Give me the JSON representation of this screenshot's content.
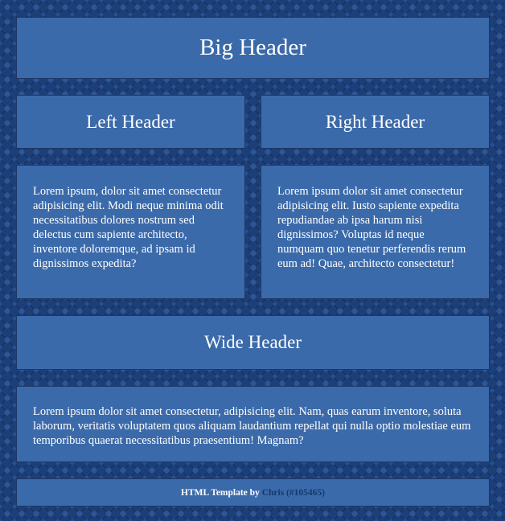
{
  "big_header": {
    "title": "Big Header"
  },
  "left_column": {
    "header": "Left Header",
    "text": "Lorem ipsum, dolor sit amet consectetur adipisicing elit. Modi neque minima odit necessitatibus dolores nostrum sed delectus cum sapiente architecto, inventore doloremque, ad ipsam id dignissimos expedita?"
  },
  "right_column": {
    "header": "Right Header",
    "text": "Lorem ipsum dolor sit amet consectetur adipisicing elit. Iusto sapiente expedita repudiandae ab ipsa harum nisi dignissimos? Voluptas id neque numquam quo tenetur perferendis rerum eum ad! Quae, architecto consectetur!"
  },
  "wide_section": {
    "header": "Wide Header",
    "text": "Lorem ipsum dolor sit amet consectetur, adipisicing elit. Nam, quas earum inventore, soluta laborum, veritatis voluptatem quos aliquam laudantium repellat qui nulla optio molestiae eum temporibus quaerat necessitatibus praesentium! Magnam?"
  },
  "footer": {
    "prefix": "HTML Template by ",
    "author": "Chris",
    "suffix": " (#105465)"
  },
  "colors": {
    "background": "#1d3f78",
    "panel": "#3b6aaa",
    "text": "#ffffff",
    "author_link": "#123a6b"
  }
}
